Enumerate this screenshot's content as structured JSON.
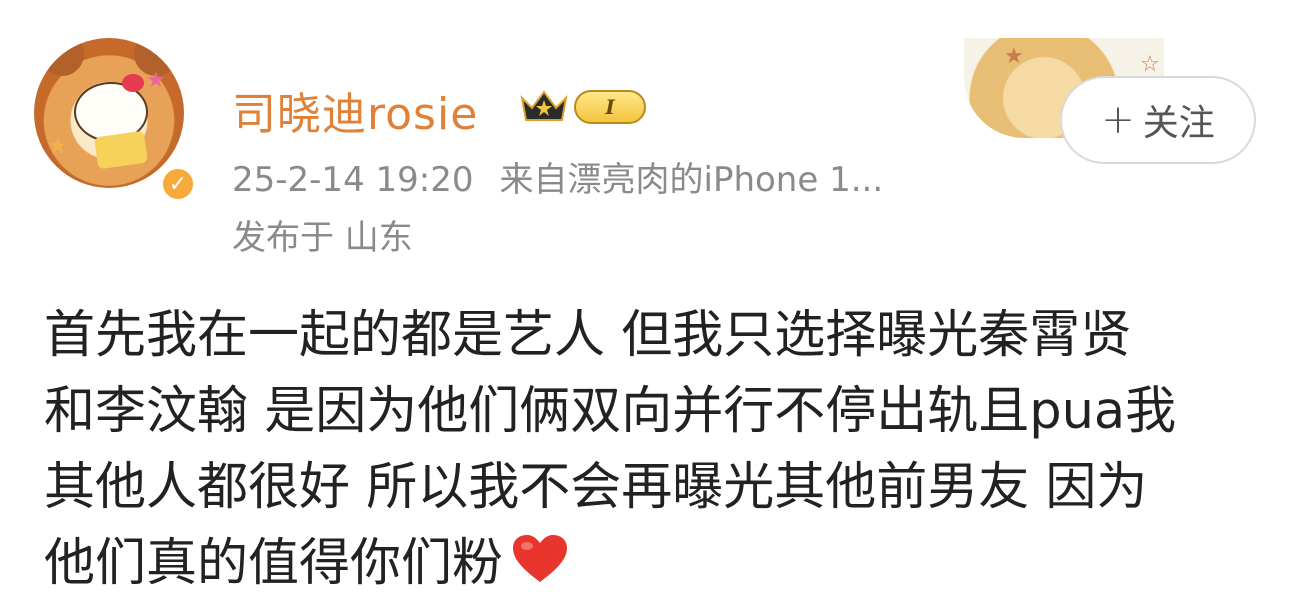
{
  "user": {
    "name": "司晓迪rosie",
    "level": "I",
    "verified_icon": "v-check-icon",
    "crown_icon": "crown-icon"
  },
  "post": {
    "timestamp": "25-2-14 19:20",
    "source": "来自漂亮肉的iPhone 1...",
    "location": "发布于 山东",
    "lines": [
      "首先我在一起的都是艺人 但我只选择曝光秦霄贤",
      "和李汶翰 是因为他们俩双向并行不停出轨且pua我",
      "其他人都很好 所以我不会再曝光其他前男友 因为",
      "他们真的值得你们粉"
    ],
    "emoji": "heart-icon"
  },
  "actions": {
    "follow_plus": "+",
    "follow_label": "关注"
  },
  "colors": {
    "username": "#e0813a",
    "meta": "#8a8a8a",
    "body_text": "#222222",
    "heart": "#e8362f",
    "badge_orange": "#f7a93a"
  }
}
